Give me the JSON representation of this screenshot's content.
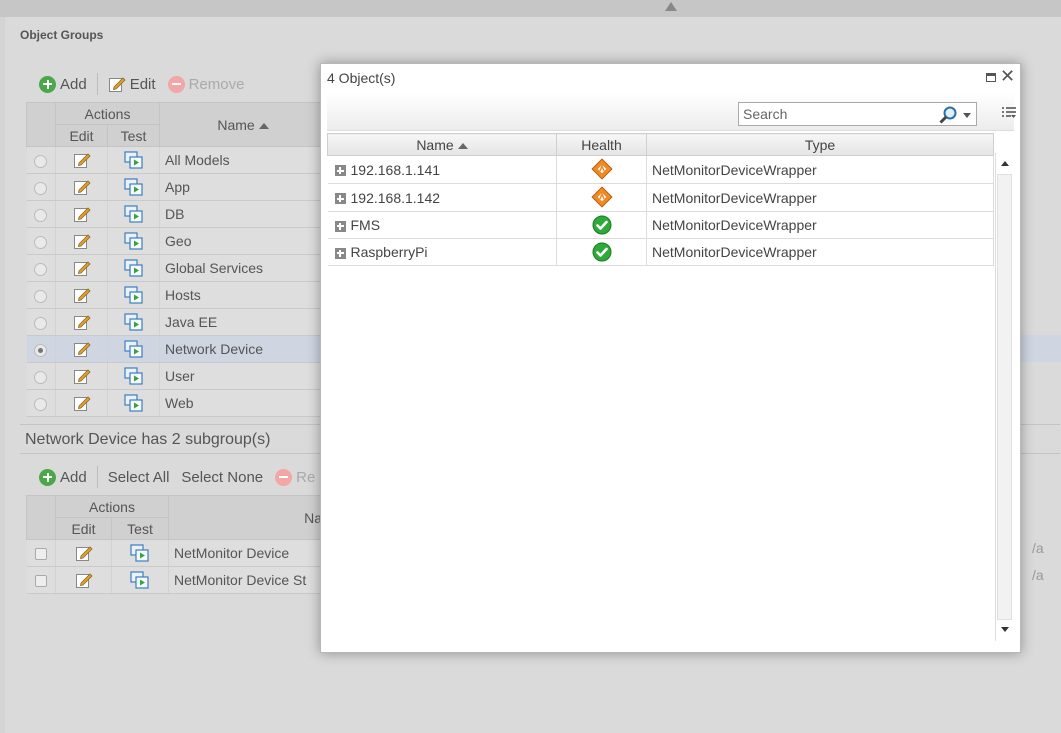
{
  "panel": {
    "title": "Object Groups"
  },
  "top_toolbar": {
    "add": "Add",
    "edit": "Edit",
    "remove": "Remove"
  },
  "groups_grid": {
    "actions_header": "Actions",
    "edit_header": "Edit",
    "test_header": "Test",
    "name_header": "Name",
    "rows": [
      {
        "name": "All Models",
        "selected": false
      },
      {
        "name": "App",
        "selected": false
      },
      {
        "name": "DB",
        "selected": false
      },
      {
        "name": "Geo",
        "selected": false
      },
      {
        "name": "Global Services",
        "selected": false
      },
      {
        "name": "Hosts",
        "selected": false
      },
      {
        "name": "Java EE",
        "selected": false
      },
      {
        "name": "Network Device",
        "selected": true
      },
      {
        "name": "User",
        "selected": false
      },
      {
        "name": "Web",
        "selected": false
      }
    ]
  },
  "subgroups": {
    "header": "Network Device has 2 subgroup(s)",
    "toolbar": {
      "add": "Add",
      "select_all": "Select All",
      "select_none": "Select None",
      "remove_partial": "Re"
    },
    "actions_header": "Actions",
    "edit_header": "Edit",
    "test_header": "Test",
    "name_header_partial": "Na",
    "rows": [
      {
        "name": "NetMonitor Device",
        "right_partial": "/a"
      },
      {
        "name": "NetMonitor Device St",
        "right_partial": "/a"
      }
    ]
  },
  "modal": {
    "title": "4 Object(s)",
    "search_placeholder": "Search",
    "columns": {
      "name": "Name",
      "health": "Health",
      "type": "Type"
    },
    "rows": [
      {
        "name": "192.168.1.141",
        "health": "warning",
        "type": "NetMonitorDeviceWrapper"
      },
      {
        "name": "192.168.1.142",
        "health": "warning",
        "type": "NetMonitorDeviceWrapper"
      },
      {
        "name": "FMS",
        "health": "ok",
        "type": "NetMonitorDeviceWrapper"
      },
      {
        "name": "RaspberryPi",
        "health": "ok",
        "type": "NetMonitorDeviceWrapper"
      }
    ]
  },
  "colors": {
    "ok": "#2eaa3a",
    "warning": "#f08a24",
    "selected_row": "#cfd6e2"
  }
}
